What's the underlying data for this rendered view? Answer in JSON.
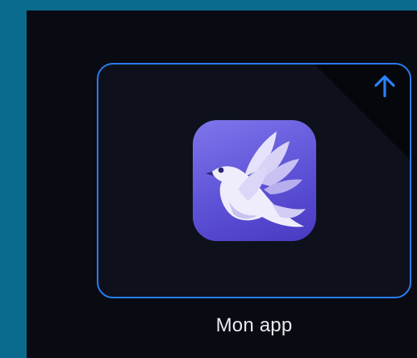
{
  "app": {
    "label": "Mon app",
    "icon": "bird-icon",
    "state_icon": "arrow-up-icon"
  },
  "colors": {
    "outer_background": "#0b6b8e",
    "screen_background": "#090b12",
    "tile_border": "#2a7cf0",
    "upload_arrow": "#2a82ff",
    "icon_gradient_start": "#7f76ec",
    "icon_gradient_end": "#4939c2",
    "label_text": "#e9e9ee"
  }
}
